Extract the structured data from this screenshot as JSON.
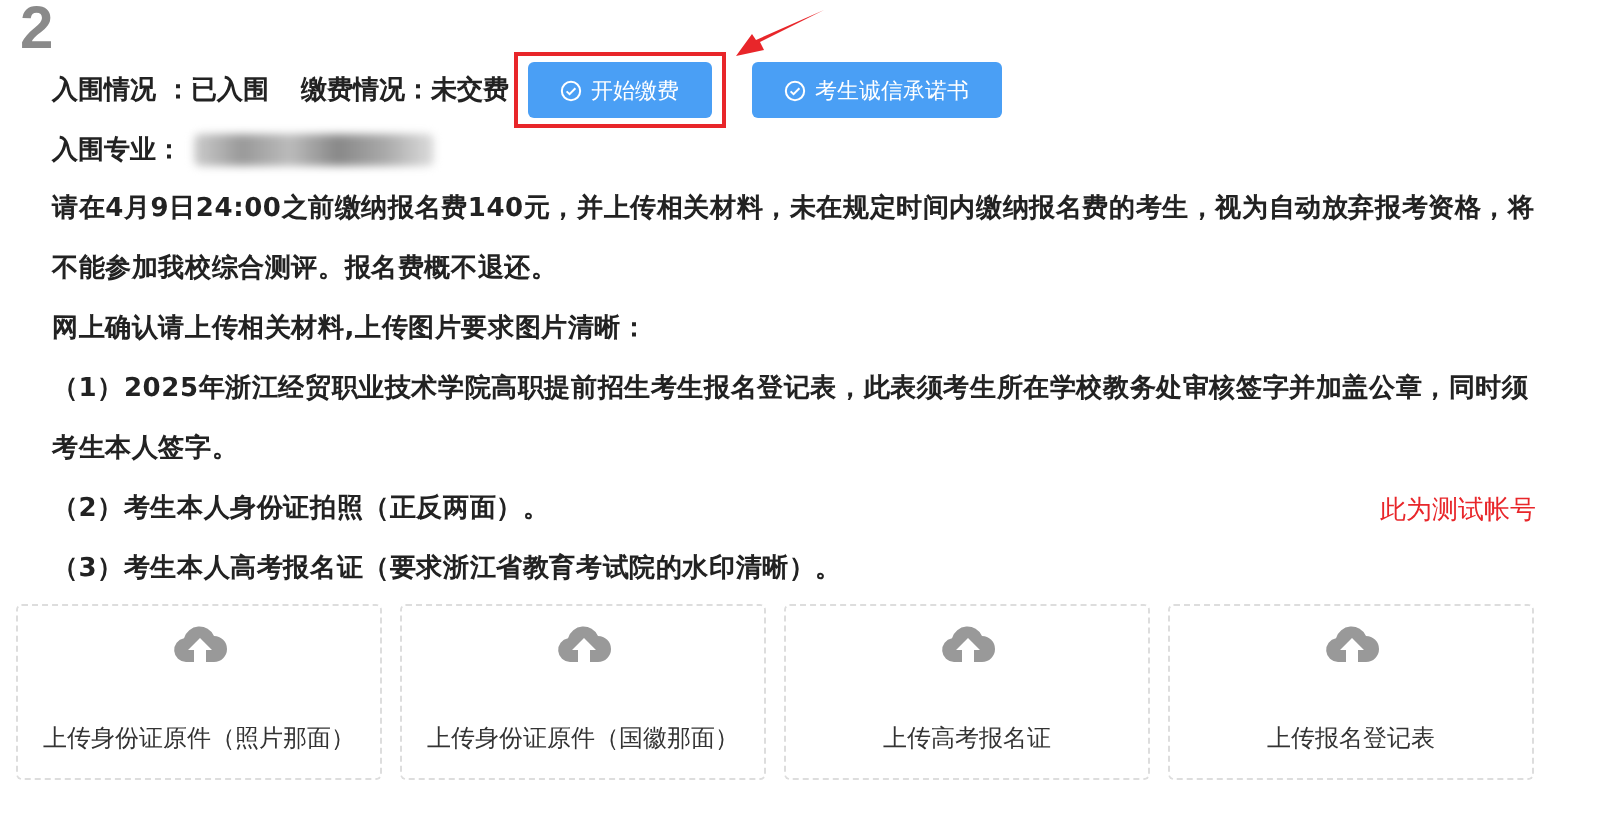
{
  "step_number": "2",
  "status_line": {
    "admit_label": "入围情况 ：已入围",
    "fee_label": "缴费情况：未交费"
  },
  "buttons": [
    {
      "label": "开始缴费",
      "highlighted": true
    },
    {
      "label": "考生诚信承诺书",
      "highlighted": false
    }
  ],
  "major": {
    "label": "入围专业："
  },
  "paragraphs": [
    "请在4月9日24:00之前缴纳报名费140元，并上传相关材料，未在规定时间内缴纳报名费的考生，视为自动放弃报考资格，将不能参加我校综合测评。报名费概不退还。",
    "网上确认请上传相关材料,上传图片要求图片清晰：",
    "（1）2025年浙江经贸职业技术学院高职提前招生考生报名登记表，此表须考生所在学校教务处审核签字并加盖公章，同时须考生本人签字。",
    "（2）考生本人身份证拍照（正反两面）。",
    "（3）考生本人高考报名证（要求浙江省教育考试院的水印清晰）。"
  ],
  "test_note": "此为测试帐号",
  "uploads": [
    {
      "label": "上传身份证原件（照片那面）"
    },
    {
      "label": "上传身份证原件（国徽那面）"
    },
    {
      "label": "上传高考报名证"
    },
    {
      "label": "上传报名登记表"
    }
  ]
}
